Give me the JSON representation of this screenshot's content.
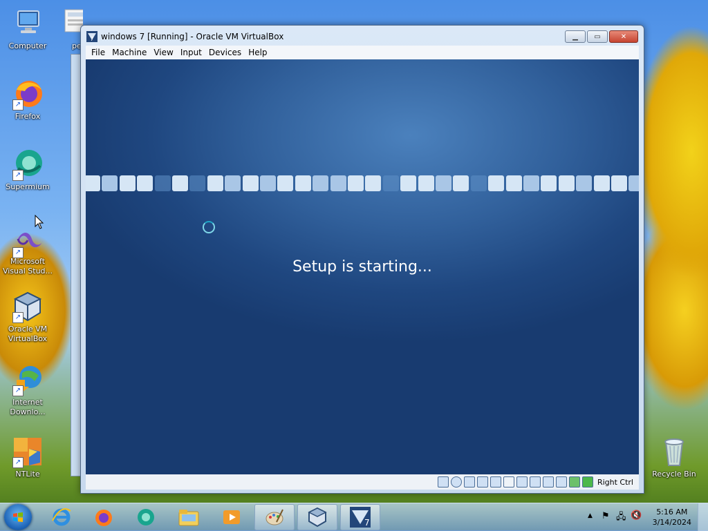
{
  "desktop": {
    "icons": [
      {
        "label": "Computer",
        "icon": "computer-icon"
      },
      {
        "label": "pe",
        "icon": "document-icon"
      },
      {
        "label": "Firefox",
        "icon": "firefox-icon"
      },
      {
        "label": "Supermium",
        "icon": "supermium-icon"
      },
      {
        "label": "Microsoft Visual Stud...",
        "icon": "visual-studio-icon"
      },
      {
        "label": "Oracle VM VirtualBox",
        "icon": "virtualbox-icon"
      },
      {
        "label": "Internet Downlo...",
        "icon": "internet-download-manager-icon"
      },
      {
        "label": "NTLite",
        "icon": "ntlite-icon"
      },
      {
        "label": "Recycle Bin",
        "icon": "recycle-bin-icon"
      }
    ]
  },
  "window": {
    "title": "windows 7 [Running] - Oracle VM VirtualBox",
    "menu": [
      "File",
      "Machine",
      "View",
      "Input",
      "Devices",
      "Help"
    ],
    "controls": [
      "minimize",
      "maximize",
      "close"
    ]
  },
  "vm_screen": {
    "message": "Setup is starting...",
    "spinner_icon": "loading-spinner-icon"
  },
  "statusbar": {
    "icons": [
      "hard-disk-icon",
      "optical-drive-icon",
      "audio-icon",
      "network-icon",
      "usb-icon",
      "shared-folders-icon",
      "display-icon",
      "video-capture-icon",
      "vrde-icon",
      "cpu-icon",
      "mouse-integration-icon",
      "keyboard-icon"
    ],
    "host_key": "Right Ctrl"
  },
  "taskbar": {
    "pinned": [
      "start-orb",
      "internet-explorer-icon",
      "firefox-icon",
      "supermium-icon",
      "file-explorer-icon",
      "media-player-icon",
      "paint-icon",
      "virtualbox-icon",
      "virtualbox-windows7-vm-icon"
    ],
    "clock_time": "5:16 AM",
    "clock_date": "3/14/2024"
  },
  "colors": {
    "screen_bg": "#2a5893",
    "desktop_sky": "#5e9de8",
    "accent_square_light": "#d6e6f5",
    "accent_square_mid": "#a9c6e6",
    "accent_square_dark": "#5e8fc7"
  }
}
